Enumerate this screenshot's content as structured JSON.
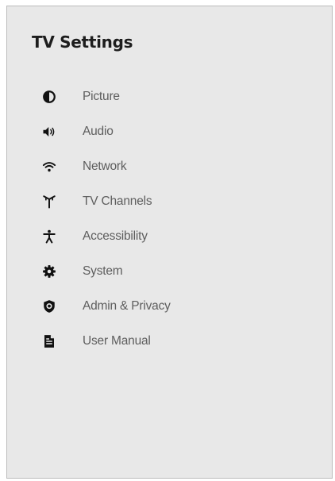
{
  "window": {
    "title": "TV Settings"
  },
  "menu": {
    "items": [
      {
        "label": "Picture",
        "icon": "contrast-icon"
      },
      {
        "label": "Audio",
        "icon": "speaker-icon"
      },
      {
        "label": "Network",
        "icon": "wifi-icon"
      },
      {
        "label": "TV Channels",
        "icon": "antenna-icon"
      },
      {
        "label": "Accessibility",
        "icon": "accessibility-icon"
      },
      {
        "label": "System",
        "icon": "gear-icon"
      },
      {
        "label": "Admin & Privacy",
        "icon": "shield-icon"
      },
      {
        "label": "User Manual",
        "icon": "document-icon"
      }
    ]
  },
  "colors": {
    "panel_background": "#e8e8e8",
    "title_text": "#1d1d1d",
    "label_text": "#5e5e5e",
    "icon": "#111111"
  }
}
